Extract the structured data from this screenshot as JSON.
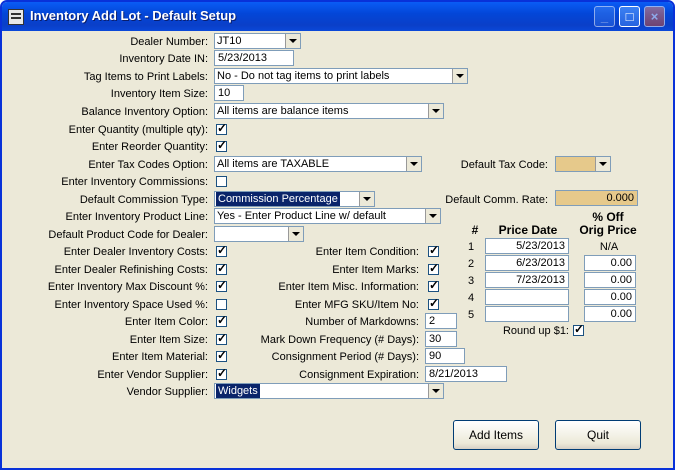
{
  "window": {
    "title": "Inventory Add Lot - Default Setup",
    "controls": {
      "minimize": "_",
      "maximize": "□",
      "close": "×"
    }
  },
  "form": {
    "dealer_number": {
      "label": "Dealer Number:",
      "value": "JT10"
    },
    "inventory_date_in": {
      "label": "Inventory Date IN:",
      "value": "5/23/2013"
    },
    "tag_items": {
      "label": "Tag Items to Print Labels:",
      "value": "No - Do not tag items to print labels"
    },
    "inventory_item_size": {
      "label": "Inventory Item Size:",
      "value": "10"
    },
    "balance_inventory": {
      "label": "Balance Inventory Option:",
      "value": "All items are balance items"
    },
    "enter_quantity": {
      "label": "Enter Quantity (multiple qty):",
      "checked": true
    },
    "enter_reorder_quantity": {
      "label": "Enter Reorder Quantity:",
      "checked": true
    },
    "tax_codes_option": {
      "label": "Enter Tax Codes Option:",
      "value": "All items are TAXABLE"
    },
    "default_tax_code": {
      "label": "Default Tax Code:",
      "value": ""
    },
    "enter_inventory_commissions": {
      "label": "Enter Inventory Commissions:",
      "checked": false
    },
    "default_commission_type": {
      "label": "Default Commission Type:",
      "value": "Commission Percentage"
    },
    "default_comm_rate": {
      "label": "Default Comm. Rate:",
      "value": "0.000"
    },
    "product_line": {
      "label": "Enter Inventory Product Line:",
      "value": "Yes - Enter Product Line w/ default"
    },
    "default_product_code": {
      "label": "Default Product Code for Dealer:",
      "value": ""
    },
    "dealer_inventory_costs": {
      "label": "Enter Dealer Inventory Costs:",
      "checked": true
    },
    "dealer_refinishing_costs": {
      "label": "Enter Dealer Refinishing Costs:",
      "checked": true
    },
    "inventory_max_discount": {
      "label": "Enter Inventory Max Discount %:",
      "checked": true
    },
    "inventory_space_used": {
      "label": "Enter Inventory Space Used %:",
      "checked": false
    },
    "item_color": {
      "label": "Enter Item Color:",
      "checked": true
    },
    "item_size": {
      "label": "Enter Item Size:",
      "checked": true
    },
    "item_material": {
      "label": "Enter Item Material:",
      "checked": true
    },
    "vendor_supplier_check": {
      "label": "Enter Vendor Supplier:",
      "checked": true
    },
    "vendor_supplier": {
      "label": "Vendor Supplier:",
      "value": "Widgets"
    },
    "item_condition": {
      "label": "Enter Item Condition:",
      "checked": true
    },
    "item_marks": {
      "label": "Enter Item Marks:",
      "checked": true
    },
    "item_misc_info": {
      "label": "Enter Item Misc. Information:",
      "checked": true
    },
    "mfg_sku": {
      "label": "Enter MFG SKU/Item No:",
      "checked": true
    },
    "number_of_markdowns": {
      "label": "Number of Markdowns:",
      "value": "2"
    },
    "markdown_frequency": {
      "label": "Mark Down Frequency (# Days):",
      "value": "30"
    },
    "consignment_period": {
      "label": "Consignment Period (# Days):",
      "value": "90"
    },
    "consignment_expiration": {
      "label": "Consignment Expiration:",
      "value": "8/21/2013"
    }
  },
  "markdowns": {
    "headers": {
      "num": "#",
      "date": "Price Date",
      "pct_line1": "% Off",
      "pct_line2": "Orig Price"
    },
    "rows": [
      {
        "n": "1",
        "date": "5/23/2013",
        "pct": "N/A"
      },
      {
        "n": "2",
        "date": "6/23/2013",
        "pct": "0.00"
      },
      {
        "n": "3",
        "date": "7/23/2013",
        "pct": "0.00"
      },
      {
        "n": "4",
        "date": "",
        "pct": "0.00"
      },
      {
        "n": "5",
        "date": "",
        "pct": "0.00"
      }
    ],
    "round_up": {
      "label": "Round up $1:",
      "checked": true
    }
  },
  "buttons": {
    "add_items": "Add Items",
    "quit": "Quit"
  }
}
